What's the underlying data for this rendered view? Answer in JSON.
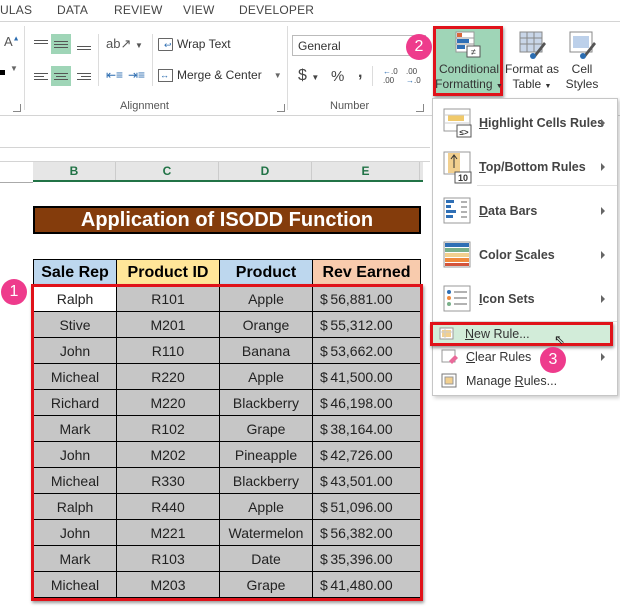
{
  "ribbon_tabs": [
    "ULAS",
    "DATA",
    "REVIEW",
    "VIEW",
    "DEVELOPER"
  ],
  "alignment": {
    "wrap_text_label": "Wrap Text",
    "merge_center_label": "Merge & Center",
    "group_label": "Alignment"
  },
  "number": {
    "format_value": "General",
    "currency_symbol": "$",
    "percent_symbol": "%",
    "comma_symbol": ",",
    "increase_decimal": "←.0 .00",
    "decrease_decimal": ".00 →.0",
    "group_label": "Number"
  },
  "styles": {
    "conditional_formatting_line1": "Conditional",
    "conditional_formatting_line2": "Formatting",
    "format_as_table_line1": "Format as",
    "format_as_table_line2": "Table",
    "cell_styles_line1": "Cell",
    "cell_styles_line2": "Styles"
  },
  "cf_menu": {
    "items": [
      {
        "label_u": "H",
        "label_rest": "ighlight Cells Rules",
        "has_submenu": true
      },
      {
        "label_u": "T",
        "label_rest": "op/Bottom Rules",
        "has_submenu": true
      },
      {
        "label_u": "D",
        "label_rest": "ata Bars",
        "has_submenu": true
      },
      {
        "label_pre": "Color ",
        "label_u": "S",
        "label_rest": "cales",
        "has_submenu": true
      },
      {
        "label_u": "I",
        "label_rest": "con Sets",
        "has_submenu": true
      }
    ],
    "new_rule": {
      "label_u": "N",
      "label_rest": "ew Rule..."
    },
    "clear_rules": {
      "label_u": "C",
      "label_rest": "lear Rules",
      "has_submenu": true
    },
    "manage_rules": {
      "label_pre": "Manage ",
      "label_u": "R",
      "label_rest": "ules..."
    }
  },
  "badges": {
    "b1": "1",
    "b2": "2",
    "b3": "3"
  },
  "columns": [
    "B",
    "C",
    "D",
    "E"
  ],
  "sheet_title": "Application of ISODD Function",
  "table": {
    "headers": [
      "Sale Rep",
      "Product ID",
      "Product",
      "Rev Earned"
    ],
    "header_colors": [
      "#bdd7ee",
      "#ffe699",
      "#bdd7ee",
      "#f8cbad"
    ],
    "rows": [
      {
        "rep": "Ralph",
        "id": "R101",
        "product": "Apple",
        "rev": "56,881.00"
      },
      {
        "rep": "Stive",
        "id": "M201",
        "product": "Orange",
        "rev": "55,312.00"
      },
      {
        "rep": "John",
        "id": "R110",
        "product": "Banana",
        "rev": "53,662.00"
      },
      {
        "rep": "Micheal",
        "id": "R220",
        "product": "Apple",
        "rev": "41,500.00"
      },
      {
        "rep": "Richard",
        "id": "M220",
        "product": "Blackberry",
        "rev": "46,198.00"
      },
      {
        "rep": "Mark",
        "id": "R102",
        "product": "Grape",
        "rev": "38,164.00"
      },
      {
        "rep": "John",
        "id": "M202",
        "product": "Pineapple",
        "rev": "42,726.00"
      },
      {
        "rep": "Micheal",
        "id": "R330",
        "product": "Blackberry",
        "rev": "43,501.00"
      },
      {
        "rep": "Ralph",
        "id": "R440",
        "product": "Apple",
        "rev": "51,096.00"
      },
      {
        "rep": "John",
        "id": "M221",
        "product": "Watermelon",
        "rev": "56,382.00"
      },
      {
        "rep": "Mark",
        "id": "R103",
        "product": "Date",
        "rev": "35,396.00"
      },
      {
        "rep": "Micheal",
        "id": "M203",
        "product": "Grape",
        "rev": "41,480.00"
      }
    ],
    "currency": "$"
  },
  "colors": {
    "accent_green": "#217346",
    "highlight_red": "#e0121a",
    "badge_pink": "#ee3b8c",
    "title_brown": "#843c0c"
  }
}
